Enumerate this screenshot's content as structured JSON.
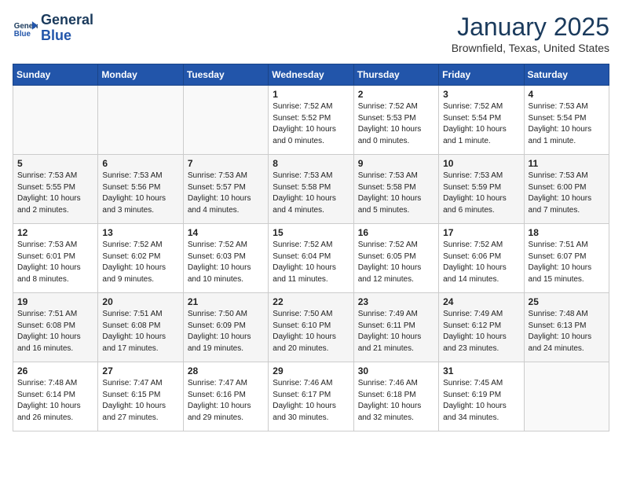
{
  "header": {
    "logo_line1": "General",
    "logo_line2": "Blue",
    "month_title": "January 2025",
    "location": "Brownfield, Texas, United States"
  },
  "weekdays": [
    "Sunday",
    "Monday",
    "Tuesday",
    "Wednesday",
    "Thursday",
    "Friday",
    "Saturday"
  ],
  "weeks": [
    [
      {
        "day": "",
        "info": ""
      },
      {
        "day": "",
        "info": ""
      },
      {
        "day": "",
        "info": ""
      },
      {
        "day": "1",
        "info": "Sunrise: 7:52 AM\nSunset: 5:52 PM\nDaylight: 10 hours\nand 0 minutes."
      },
      {
        "day": "2",
        "info": "Sunrise: 7:52 AM\nSunset: 5:53 PM\nDaylight: 10 hours\nand 0 minutes."
      },
      {
        "day": "3",
        "info": "Sunrise: 7:52 AM\nSunset: 5:54 PM\nDaylight: 10 hours\nand 1 minute."
      },
      {
        "day": "4",
        "info": "Sunrise: 7:53 AM\nSunset: 5:54 PM\nDaylight: 10 hours\nand 1 minute."
      }
    ],
    [
      {
        "day": "5",
        "info": "Sunrise: 7:53 AM\nSunset: 5:55 PM\nDaylight: 10 hours\nand 2 minutes."
      },
      {
        "day": "6",
        "info": "Sunrise: 7:53 AM\nSunset: 5:56 PM\nDaylight: 10 hours\nand 3 minutes."
      },
      {
        "day": "7",
        "info": "Sunrise: 7:53 AM\nSunset: 5:57 PM\nDaylight: 10 hours\nand 4 minutes."
      },
      {
        "day": "8",
        "info": "Sunrise: 7:53 AM\nSunset: 5:58 PM\nDaylight: 10 hours\nand 4 minutes."
      },
      {
        "day": "9",
        "info": "Sunrise: 7:53 AM\nSunset: 5:58 PM\nDaylight: 10 hours\nand 5 minutes."
      },
      {
        "day": "10",
        "info": "Sunrise: 7:53 AM\nSunset: 5:59 PM\nDaylight: 10 hours\nand 6 minutes."
      },
      {
        "day": "11",
        "info": "Sunrise: 7:53 AM\nSunset: 6:00 PM\nDaylight: 10 hours\nand 7 minutes."
      }
    ],
    [
      {
        "day": "12",
        "info": "Sunrise: 7:53 AM\nSunset: 6:01 PM\nDaylight: 10 hours\nand 8 minutes."
      },
      {
        "day": "13",
        "info": "Sunrise: 7:52 AM\nSunset: 6:02 PM\nDaylight: 10 hours\nand 9 minutes."
      },
      {
        "day": "14",
        "info": "Sunrise: 7:52 AM\nSunset: 6:03 PM\nDaylight: 10 hours\nand 10 minutes."
      },
      {
        "day": "15",
        "info": "Sunrise: 7:52 AM\nSunset: 6:04 PM\nDaylight: 10 hours\nand 11 minutes."
      },
      {
        "day": "16",
        "info": "Sunrise: 7:52 AM\nSunset: 6:05 PM\nDaylight: 10 hours\nand 12 minutes."
      },
      {
        "day": "17",
        "info": "Sunrise: 7:52 AM\nSunset: 6:06 PM\nDaylight: 10 hours\nand 14 minutes."
      },
      {
        "day": "18",
        "info": "Sunrise: 7:51 AM\nSunset: 6:07 PM\nDaylight: 10 hours\nand 15 minutes."
      }
    ],
    [
      {
        "day": "19",
        "info": "Sunrise: 7:51 AM\nSunset: 6:08 PM\nDaylight: 10 hours\nand 16 minutes."
      },
      {
        "day": "20",
        "info": "Sunrise: 7:51 AM\nSunset: 6:08 PM\nDaylight: 10 hours\nand 17 minutes."
      },
      {
        "day": "21",
        "info": "Sunrise: 7:50 AM\nSunset: 6:09 PM\nDaylight: 10 hours\nand 19 minutes."
      },
      {
        "day": "22",
        "info": "Sunrise: 7:50 AM\nSunset: 6:10 PM\nDaylight: 10 hours\nand 20 minutes."
      },
      {
        "day": "23",
        "info": "Sunrise: 7:49 AM\nSunset: 6:11 PM\nDaylight: 10 hours\nand 21 minutes."
      },
      {
        "day": "24",
        "info": "Sunrise: 7:49 AM\nSunset: 6:12 PM\nDaylight: 10 hours\nand 23 minutes."
      },
      {
        "day": "25",
        "info": "Sunrise: 7:48 AM\nSunset: 6:13 PM\nDaylight: 10 hours\nand 24 minutes."
      }
    ],
    [
      {
        "day": "26",
        "info": "Sunrise: 7:48 AM\nSunset: 6:14 PM\nDaylight: 10 hours\nand 26 minutes."
      },
      {
        "day": "27",
        "info": "Sunrise: 7:47 AM\nSunset: 6:15 PM\nDaylight: 10 hours\nand 27 minutes."
      },
      {
        "day": "28",
        "info": "Sunrise: 7:47 AM\nSunset: 6:16 PM\nDaylight: 10 hours\nand 29 minutes."
      },
      {
        "day": "29",
        "info": "Sunrise: 7:46 AM\nSunset: 6:17 PM\nDaylight: 10 hours\nand 30 minutes."
      },
      {
        "day": "30",
        "info": "Sunrise: 7:46 AM\nSunset: 6:18 PM\nDaylight: 10 hours\nand 32 minutes."
      },
      {
        "day": "31",
        "info": "Sunrise: 7:45 AM\nSunset: 6:19 PM\nDaylight: 10 hours\nand 34 minutes."
      },
      {
        "day": "",
        "info": ""
      }
    ]
  ]
}
